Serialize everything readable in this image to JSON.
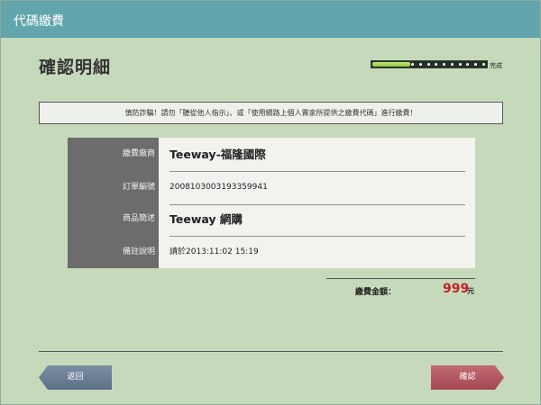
{
  "header": {
    "title": "代碼繳費"
  },
  "page": {
    "title": "確認明細"
  },
  "progress": {
    "fraction": 0.33,
    "label": "完成"
  },
  "warning": {
    "text": "慎防詐騙！請勿「聽從他人指示」、或「使用網路上個人賣家所提供之繳費代碼」進行繳費！"
  },
  "details": {
    "rows": [
      {
        "label": "繳費廠商",
        "value": "Teeway-福隆國際"
      },
      {
        "label": "訂單編號",
        "value": "2008103003193359941"
      },
      {
        "label": "商品簡述",
        "value": "Teeway 網購"
      },
      {
        "label": "備註說明",
        "value": "請於2013:11:02 15:19"
      }
    ]
  },
  "total": {
    "label": "繳費金額：",
    "amount": "999",
    "unit": "元",
    "amount_color": "#c0252a"
  },
  "buttons": {
    "back_label": "返回",
    "confirm_label": "確認"
  },
  "colors": {
    "titlebar": "#62a5ad",
    "background": "#c7d9bb",
    "back_button": "#6a7e95",
    "confirm_button": "#b35861"
  }
}
